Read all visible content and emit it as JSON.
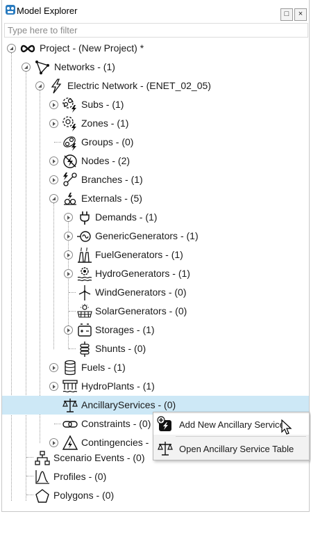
{
  "window": {
    "title": "Model Explorer",
    "restore_glyph": "□",
    "close_glyph": "×"
  },
  "filter": {
    "placeholder": "Type here to filter",
    "value": ""
  },
  "tree": {
    "project": "Project - (New Project) *",
    "networks": "Networks - (1)",
    "electric_network": "Electric Network - (ENET_02_05)",
    "subs": "Subs - (1)",
    "zones": "Zones - (1)",
    "groups": "Groups - (0)",
    "nodes": "Nodes - (2)",
    "branches": "Branches - (1)",
    "externals": "Externals - (5)",
    "demands": "Demands - (1)",
    "generic_generators": "GenericGenerators - (1)",
    "fuel_generators": "FuelGenerators - (1)",
    "hydro_generators": "HydroGenerators - (1)",
    "wind_generators": "WindGenerators - (0)",
    "solar_generators": "SolarGenerators - (0)",
    "storages": "Storages - (1)",
    "shunts": "Shunts - (0)",
    "fuels": "Fuels - (1)",
    "hydro_plants": "HydroPlants - (1)",
    "ancillary_services": "AncillaryServices - (0)",
    "constraints": "Constraints - (0)",
    "contingencies": "Contingencies -",
    "scenario_events": "Scenario Events - (0)",
    "profiles": "Profiles - (0)",
    "polygons": "Polygons - (0)"
  },
  "context_menu": {
    "add_new": "Add New Ancillary Service",
    "open_table": "Open Ancillary Service Table"
  },
  "colors": {
    "selection": "#cde8f6",
    "menu_bg": "#f2f2f2"
  }
}
